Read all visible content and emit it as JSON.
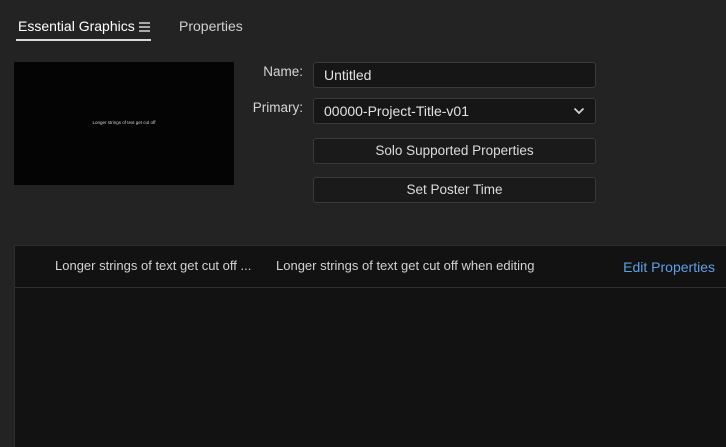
{
  "tabs": [
    {
      "label": "Essential Graphics",
      "active": true
    },
    {
      "label": "Properties",
      "active": false
    }
  ],
  "preview": {
    "text": "Longer strings of text get cut off"
  },
  "fields": {
    "name_label": "Name:",
    "name_value": "Untitled",
    "primary_label": "Primary:",
    "primary_value": "00000-Project-Title-v01"
  },
  "buttons": {
    "solo": "Solo Supported Properties",
    "poster": "Set Poster Time"
  },
  "layers": {
    "item_name": "Longer strings of text get cut off ...",
    "item_text": "Longer strings of text get cut off when editing",
    "edit_link": "Edit Properties"
  },
  "icons": {
    "menu": "hamburger-menu-icon",
    "dropdown": "chevron-down-icon"
  },
  "colors": {
    "panel_bg": "#232323",
    "link": "#5aa0e8",
    "field_bg": "#161616"
  }
}
